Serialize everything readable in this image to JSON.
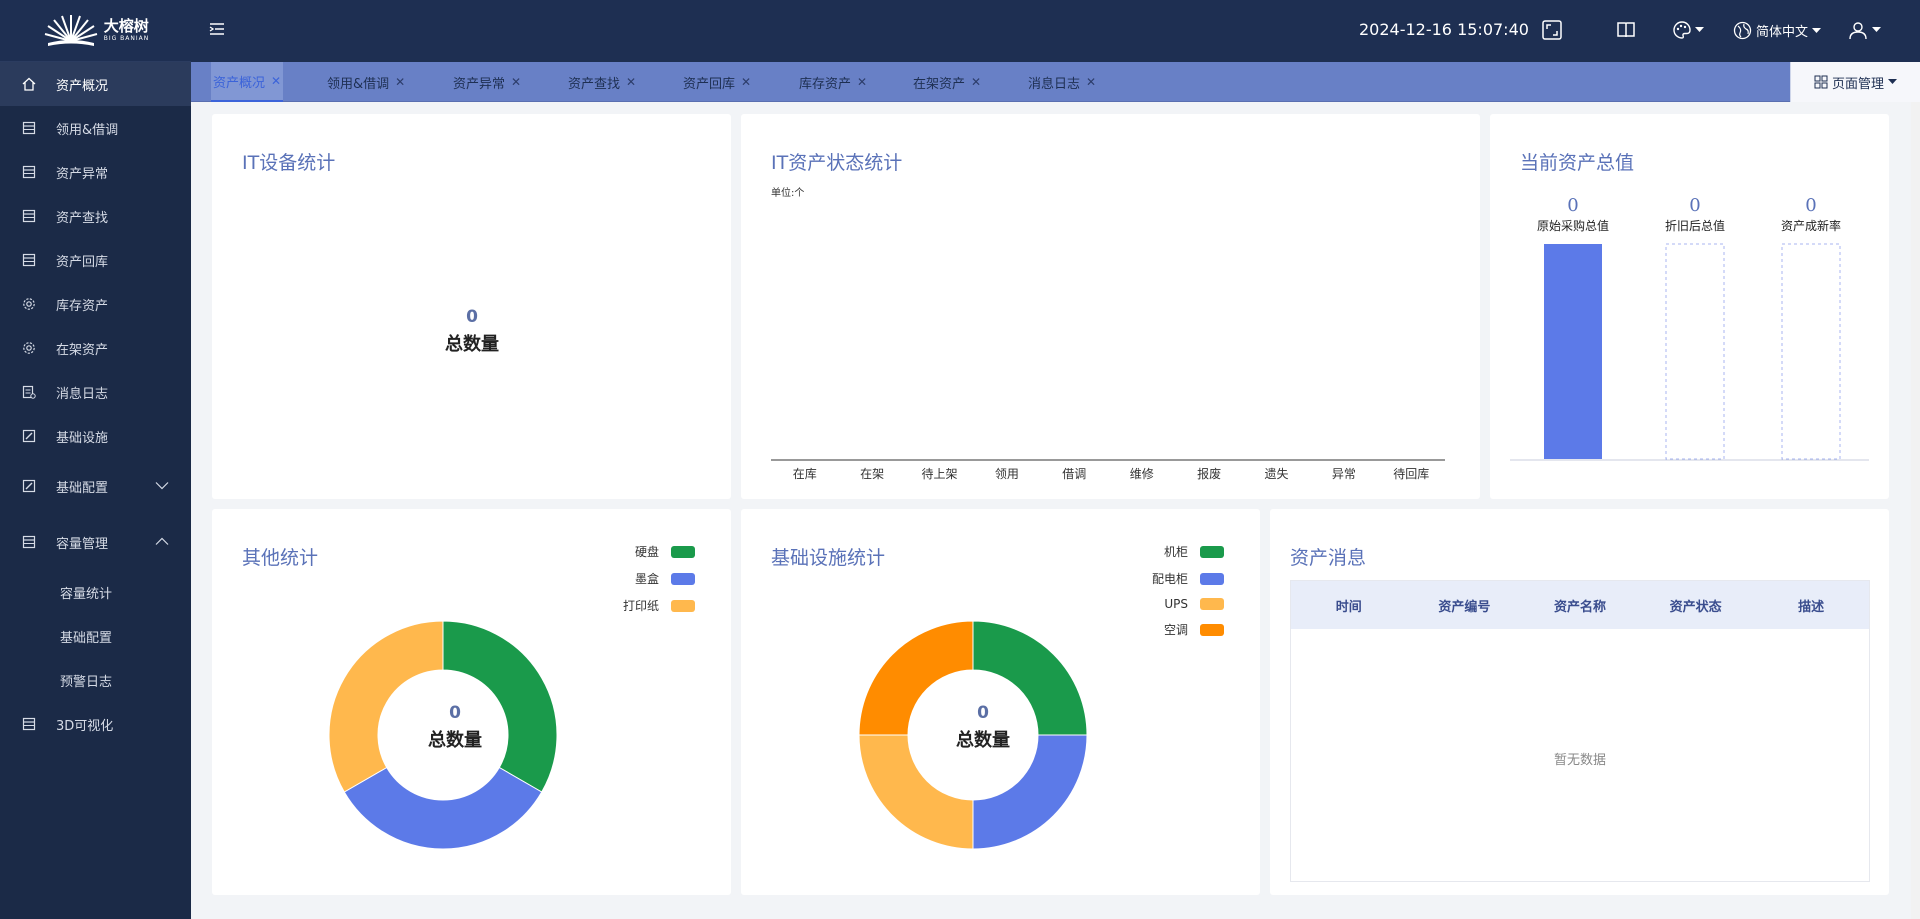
{
  "brand": {
    "name_cn": "大榕树",
    "name_en": "BIG BANIAN"
  },
  "sidebar": {
    "items": [
      {
        "label": "资产概况",
        "icon": "home-icon",
        "active": true
      },
      {
        "label": "领用&借调",
        "icon": "document-icon"
      },
      {
        "label": "资产异常",
        "icon": "document-icon"
      },
      {
        "label": "资产查找",
        "icon": "document-icon"
      },
      {
        "label": "资产回库",
        "icon": "document-icon"
      },
      {
        "label": "库存资产",
        "icon": "gear-icon"
      },
      {
        "label": "在架资产",
        "icon": "gear-icon"
      },
      {
        "label": "消息日志",
        "icon": "log-icon"
      },
      {
        "label": "基础设施",
        "icon": "edit-icon"
      },
      {
        "label": "基础配置",
        "icon": "edit-icon",
        "expandable": true,
        "expanded": false
      },
      {
        "label": "容量管理",
        "icon": "document-icon",
        "expandable": true,
        "expanded": true
      },
      {
        "label": "3D可视化",
        "icon": "document-icon"
      }
    ],
    "submenu": [
      {
        "label": "容量统计"
      },
      {
        "label": "基础配置"
      },
      {
        "label": "预警日志"
      }
    ]
  },
  "topbar": {
    "datetime": "2024-12-16 15:07:40",
    "language": "简体中文"
  },
  "tabs": [
    {
      "label": "资产概况",
      "active": true
    },
    {
      "label": "领用&借调"
    },
    {
      "label": "资产异常"
    },
    {
      "label": "资产查找"
    },
    {
      "label": "资产回库"
    },
    {
      "label": "库存资产"
    },
    {
      "label": "在架资产"
    },
    {
      "label": "消息日志"
    }
  ],
  "page_manager_label": "页面管理",
  "it_device": {
    "title": "IT设备统计",
    "total": "0",
    "total_label": "总数量"
  },
  "it_status": {
    "title": "IT资产状态统计",
    "unit": "单位:个"
  },
  "asset_value": {
    "title": "当前资产总值"
  },
  "other_stats": {
    "title": "其他统计",
    "total": "0",
    "total_label": "总数量"
  },
  "infra_stats": {
    "title": "基础设施统计",
    "total": "0",
    "total_label": "总数量"
  },
  "asset_messages": {
    "title": "资产消息",
    "columns": [
      "时间",
      "资产编号",
      "资产名称",
      "资产状态",
      "描述"
    ],
    "empty_text": "暂无数据"
  },
  "colors": {
    "green": "#1a9a4b",
    "blue": "#5c7ae8",
    "yellow": "#ffb84d",
    "orange": "#ff8c00",
    "title_blue": "#5a72b8"
  },
  "chart_data": [
    {
      "type": "bar",
      "title": "IT资产状态统计",
      "ylabel": "单位:个",
      "categories": [
        "在库",
        "在架",
        "待上架",
        "领用",
        "借调",
        "维修",
        "报废",
        "遗失",
        "异常",
        "待回库"
      ],
      "values": [
        0,
        0,
        0,
        0,
        0,
        0,
        0,
        0,
        0,
        0
      ]
    },
    {
      "type": "bar",
      "title": "当前资产总值",
      "categories": [
        "原始采购总值",
        "折旧后总值",
        "资产成新率"
      ],
      "values": [
        0,
        0,
        0
      ]
    },
    {
      "type": "pie",
      "title": "其他统计",
      "categories": [
        "硬盘",
        "墨盒",
        "打印纸"
      ],
      "values": [
        1,
        1,
        1
      ],
      "colors": [
        "#1a9a4b",
        "#5c7ae8",
        "#ffb84d"
      ],
      "legend": "top-right"
    },
    {
      "type": "pie",
      "title": "基础设施统计",
      "categories": [
        "机柜",
        "配电柜",
        "UPS",
        "空调"
      ],
      "values": [
        1,
        1,
        1,
        1
      ],
      "colors": [
        "#1a9a4b",
        "#5c7ae8",
        "#ffb84d",
        "#ff8c00"
      ],
      "legend": "top-right"
    }
  ]
}
